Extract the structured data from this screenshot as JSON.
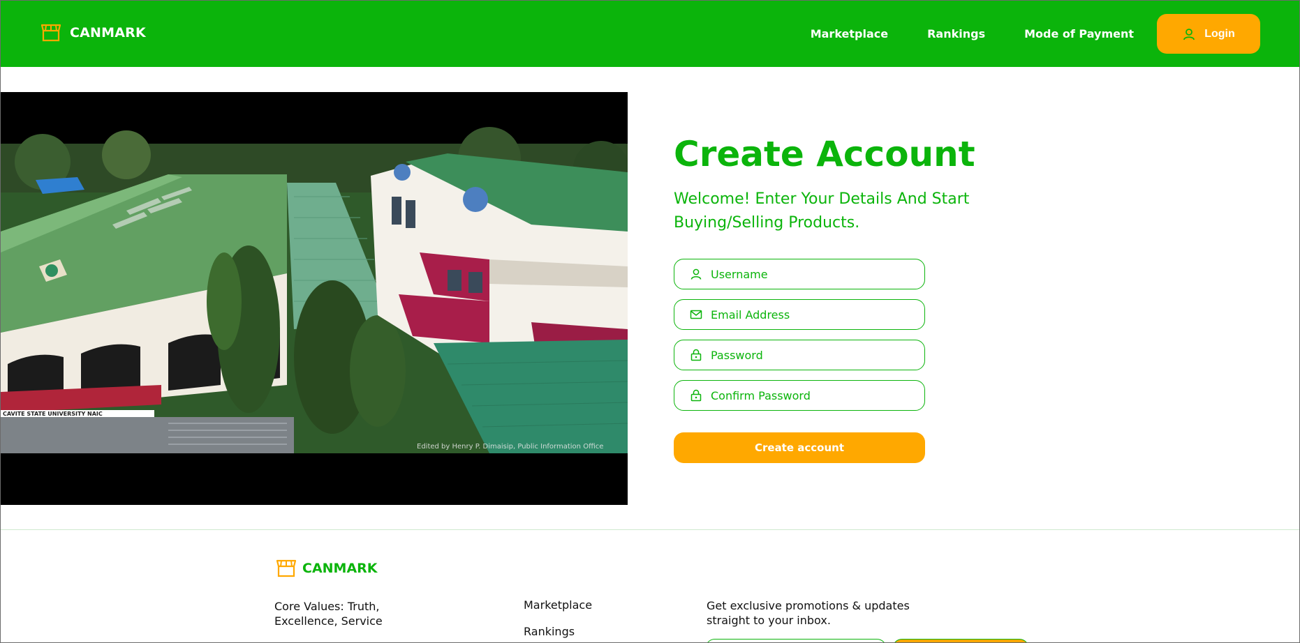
{
  "header": {
    "brand": "CANMARK",
    "nav": [
      "Marketplace",
      "Rankings",
      "Mode of Payment"
    ],
    "login_label": "Login"
  },
  "hero": {
    "video_caption": "Edited by Henry P. Dimaisip, Public Information Office",
    "building_sign": "CAVITE STATE UNIVERSITY NAIC"
  },
  "form": {
    "title": "Create Account",
    "subtitle": "Welcome! Enter Your Details And Start Buying/Selling Products.",
    "fields": {
      "username": "Username",
      "email": "Email Address",
      "password": "Password",
      "confirm_password": "Confirm Password"
    },
    "submit_label": "Create account"
  },
  "footer": {
    "brand": "CANMARK",
    "core_values": "Core Values: Truth, Excellence, Service",
    "links": [
      "Marketplace",
      "Rankings"
    ],
    "newsletter": "Get exclusive promotions & updates straight to your inbox."
  },
  "colors": {
    "primary_green": "#0bb40b",
    "accent_orange": "#ffa800"
  }
}
